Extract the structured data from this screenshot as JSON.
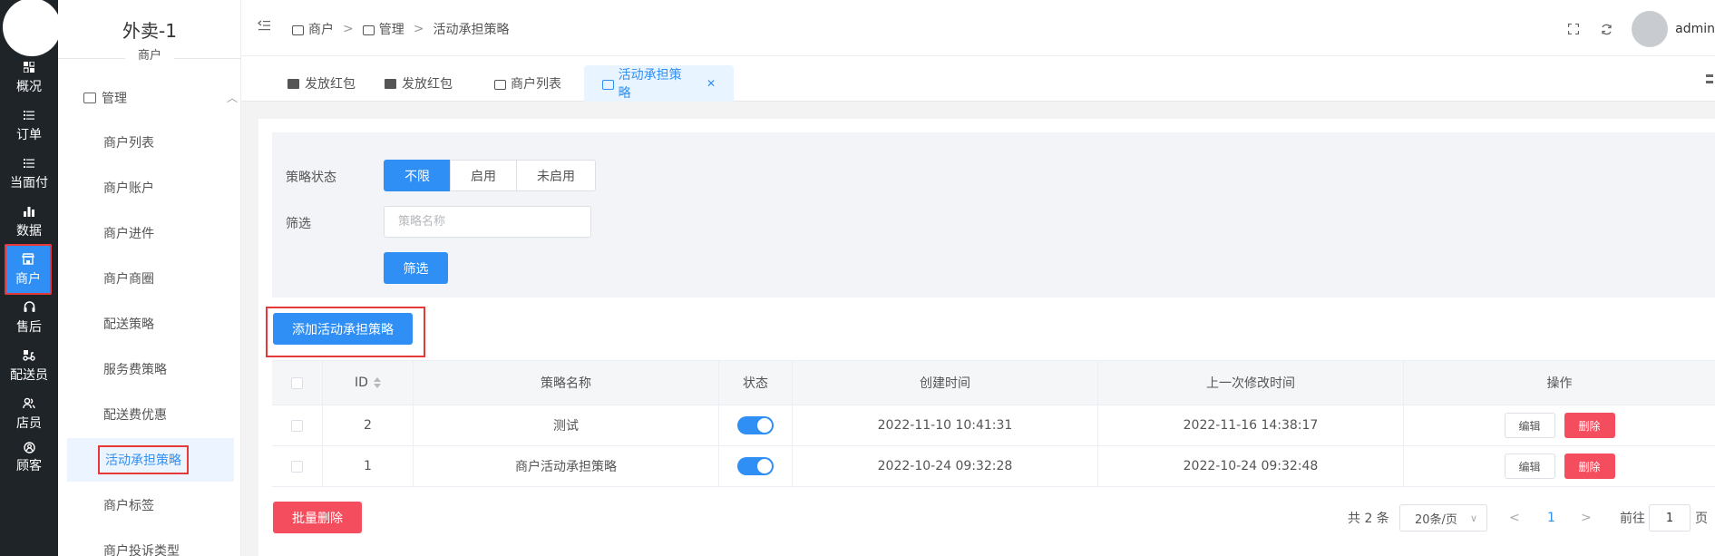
{
  "rail": {
    "items": [
      {
        "label": "概况",
        "icon": "dashboard-icon"
      },
      {
        "label": "订单",
        "icon": "list-icon"
      },
      {
        "label": "当面付",
        "icon": "list-icon"
      },
      {
        "label": "数据",
        "icon": "bar-chart-icon"
      },
      {
        "label": "商户",
        "icon": "shop-icon"
      },
      {
        "label": "售后",
        "icon": "headset-icon"
      },
      {
        "label": "配送员",
        "icon": "scooter-icon"
      },
      {
        "label": "店员",
        "icon": "users-icon"
      },
      {
        "label": "顾客",
        "icon": "user-icon"
      }
    ],
    "active_color": "#2f8ff5"
  },
  "submenu": {
    "title": "外卖-1",
    "subtitle": "商户",
    "group_label": "管理",
    "items": [
      "商户列表",
      "商户账户",
      "商户进件",
      "商户商圈",
      "配送策略",
      "服务费策略",
      "配送费优惠",
      "活动承担策略",
      "商户标签",
      "商户投诉类型"
    ]
  },
  "header": {
    "breadcrumb": [
      "商户",
      "管理",
      "活动承担策略"
    ],
    "user": "admin"
  },
  "tabs": [
    {
      "label": "发放红包"
    },
    {
      "label": "发放红包"
    },
    {
      "label": "商户列表"
    },
    {
      "label": "活动承担策略"
    }
  ],
  "filter": {
    "status_label": "策略状态",
    "status_options": [
      "不限",
      "启用",
      "未启用"
    ],
    "filter_label": "筛选",
    "name_placeholder": "策略名称",
    "submit_label": "筛选"
  },
  "actions": {
    "add_label": "添加活动承担策略",
    "batch_delete_label": "批量删除"
  },
  "table": {
    "columns": [
      "ID",
      "策略名称",
      "状态",
      "创建时间",
      "上一次修改时间",
      "操作"
    ],
    "rows": [
      {
        "id": "2",
        "name": "测试",
        "created": "2022-11-10 10:41:31",
        "modified": "2022-11-16 14:38:17",
        "edit": "编辑",
        "delete": "删除"
      },
      {
        "id": "1",
        "name": "商户活动承担策略",
        "created": "2022-10-24 09:32:28",
        "modified": "2022-10-24 09:32:48",
        "edit": "编辑",
        "delete": "删除"
      }
    ]
  },
  "pagination": {
    "total": "共 2 条",
    "page_size": "20条/页",
    "prev": "<",
    "current": "1",
    "next": ">",
    "goto_label": "前往",
    "goto_value": "1",
    "page_unit": "页"
  }
}
